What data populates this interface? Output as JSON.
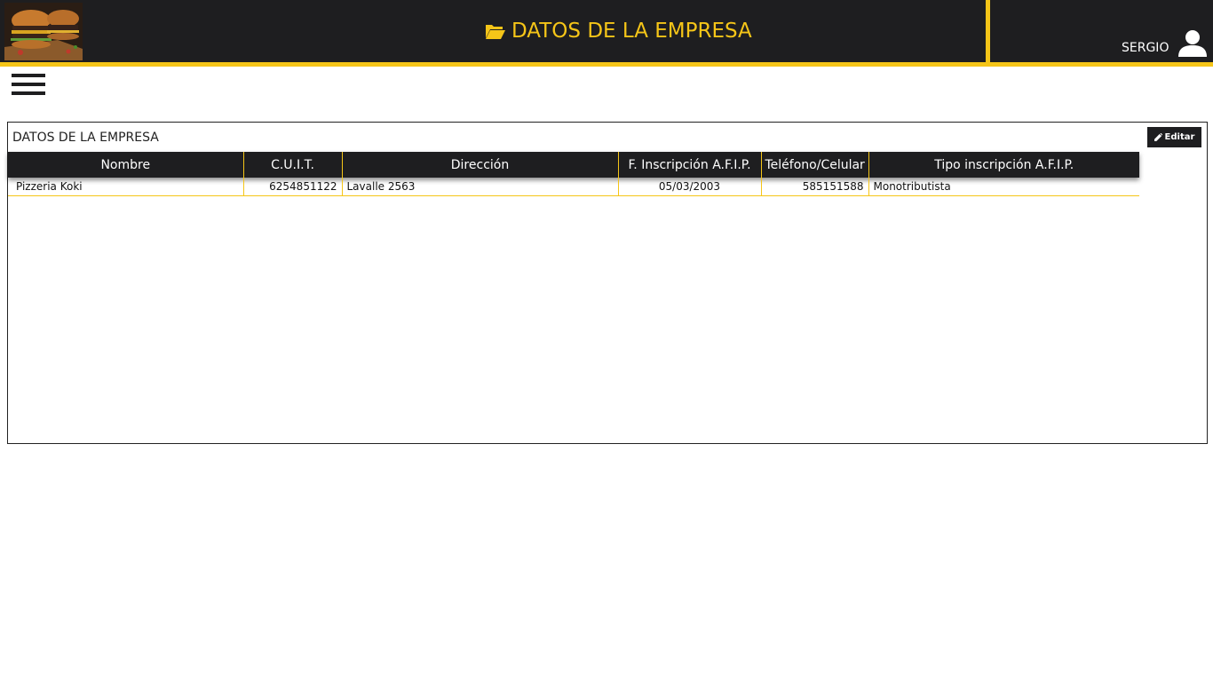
{
  "header": {
    "title": "DATOS DE LA EMPRESA",
    "title_icon": "folder-open-icon",
    "user_name": "SERGIO",
    "user_icon": "user-icon",
    "logo": "burger-logo",
    "colors": {
      "bar": "#1e1e20",
      "accent": "#f5c518"
    }
  },
  "panel": {
    "title": "DATOS DE LA EMPRESA",
    "edit_label": "Editar",
    "edit_icon": "pencil-icon"
  },
  "table": {
    "columns": [
      "Nombre",
      "C.U.I.T.",
      "Dirección",
      "F. Inscripción A.F.I.P.",
      "Teléfono/Celular",
      "Tipo inscripción A.F.I.P."
    ],
    "rows": [
      [
        "Pizzeria Koki",
        "6254851122",
        "Lavalle 2563",
        "05/03/2003",
        "585151588",
        "Monotributista"
      ]
    ]
  }
}
